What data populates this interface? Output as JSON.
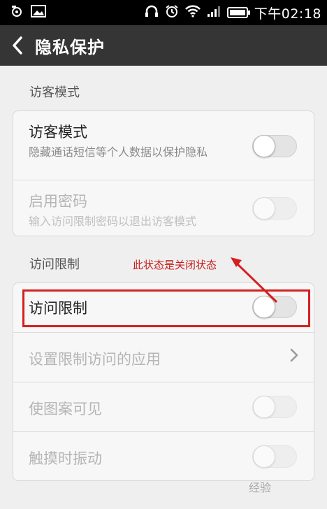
{
  "status_bar": {
    "time": "下午02:18",
    "colors": {
      "background": "#000000",
      "text": "#ffffff"
    },
    "left_icons": [
      "camera-icon",
      "image-icon"
    ],
    "right_icons": [
      "headphones-icon",
      "alarm-icon",
      "wifi-icon",
      "signal-icon",
      "battery-icon"
    ]
  },
  "title_bar": {
    "title": "隐私保护",
    "back_icon": "chevron-left-icon",
    "background": "#353535"
  },
  "sections": [
    {
      "header": "访客模式",
      "items": [
        {
          "title": "访客模式",
          "subtitle": "隐藏通话短信等个人数据以保护隐私",
          "toggle": "off",
          "enabled": true
        },
        {
          "title": "启用密码",
          "subtitle": "输入访问限制密码以退出访客模式",
          "toggle": "off",
          "enabled": false
        }
      ]
    },
    {
      "header": "访问限制",
      "items": [
        {
          "title": "访问限制",
          "toggle": "off",
          "enabled": true
        },
        {
          "title": "设置限制访问的应用",
          "control": "chevron-right-icon",
          "enabled": false
        },
        {
          "title": "使图案可见",
          "toggle": "off",
          "enabled": false
        },
        {
          "title": "触摸时振动",
          "toggle": "off",
          "enabled": false
        }
      ]
    }
  ],
  "annotation": {
    "text": "此状态是关闭状态",
    "color": "#c81e1e"
  },
  "watermark": {
    "text": "经验"
  }
}
